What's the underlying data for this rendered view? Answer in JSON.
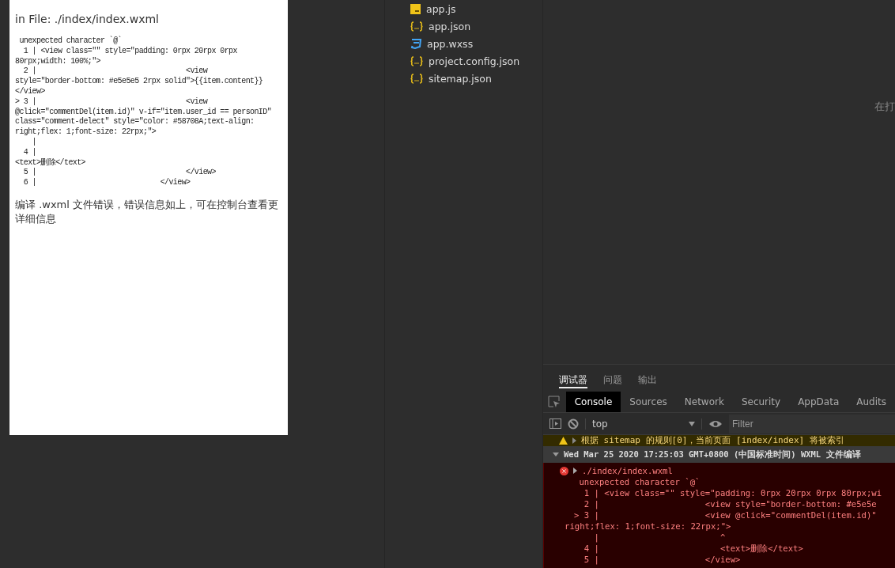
{
  "simulator": {
    "file_line": "in File: ./index/index.wxml",
    "code_lines": [
      " unexpected character `@`",
      "  1 | <view class=\"\" style=\"padding: 0rpx 20rpx 0rpx",
      "80rpx;width: 100%;\">",
      "  2 |                                   <view",
      "style=\"border-bottom: #e5e5e5 2rpx solid\">{{item.content}}",
      "</view>",
      "> 3 |                                   <view",
      "@click=\"commentDel(item.id)\" v-if=\"item.user_id == personID\"",
      "class=\"comment-delect\" style=\"color: #58708A;text-align:",
      "right;flex: 1;font-size: 22rpx;\">",
      "    |",
      "  4 |",
      "<text>删除</text>",
      "  5 |                                   </view>",
      "  6 |                             </view>"
    ],
    "message": "编译 .wxml 文件错误，错误信息如上，可在控制台查看更详细信息"
  },
  "files": [
    {
      "name": "app.js",
      "kind": "script"
    },
    {
      "name": "app.json",
      "kind": "config"
    },
    {
      "name": "app.wxss",
      "kind": "style"
    },
    {
      "name": "project.config.json",
      "kind": "config"
    },
    {
      "name": "sitemap.json",
      "kind": "config"
    }
  ],
  "editor_hint": "在打",
  "panel_tabs": [
    {
      "label": "调试器",
      "selected": true
    },
    {
      "label": "问题",
      "selected": false
    },
    {
      "label": "输出",
      "selected": false
    }
  ],
  "devtools_tabs": [
    {
      "label": "Console",
      "selected": true
    },
    {
      "label": "Sources",
      "selected": false
    },
    {
      "label": "Network",
      "selected": false
    },
    {
      "label": "Security",
      "selected": false
    },
    {
      "label": "AppData",
      "selected": false
    },
    {
      "label": "Audits",
      "selected": false
    }
  ],
  "console_toolbar": {
    "context": "top",
    "filter_placeholder": "Filter"
  },
  "warning": "根据 sitemap 的规则[0]，当前页面 [index/index] 将被索引",
  "group_header": "Wed Mar 25 2020 17:25:03 GMT+0800 (中国标准时间)  WXML 文件编译",
  "error": {
    "source": "./index/index.wxml",
    "lines": [
      " unexpected character `@`",
      "  1 | <view class=\"\" style=\"padding: 0rpx 20rpx 0rpx 80rpx;wi",
      "  2 |                     <view style=\"border-bottom: #e5e5e",
      "> 3 |                     <view @click=\"commentDel(item.id)\"",
      "right;flex: 1;font-size: 22rpx;\">",
      "    |                        ^",
      "  4 |                        <text>删除</text>",
      "  5 |                     </view>"
    ]
  }
}
